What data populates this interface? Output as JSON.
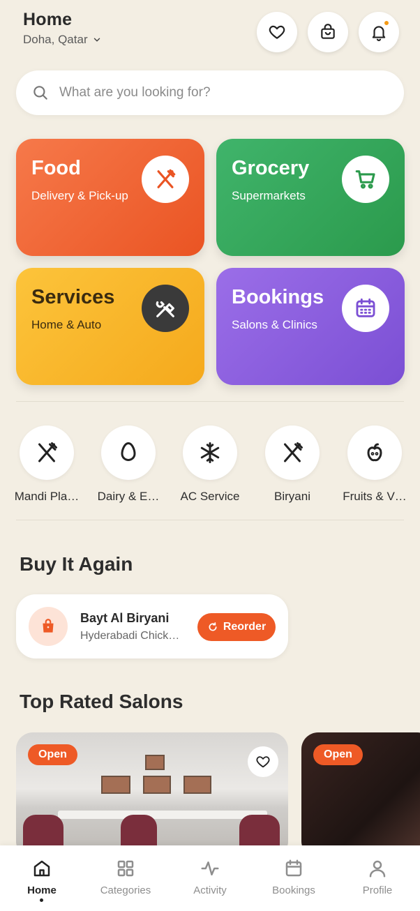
{
  "header": {
    "title": "Home",
    "location": "Doha, Qatar"
  },
  "search": {
    "placeholder": "What are you looking for?"
  },
  "categories": [
    {
      "name": "Food",
      "subtitle": "Delivery & Pick-up",
      "color": "#ea5423",
      "icon": "fork-knife-icon"
    },
    {
      "name": "Grocery",
      "subtitle": "Supermarkets",
      "color": "#2b9a4c",
      "icon": "cart-icon"
    },
    {
      "name": "Services",
      "subtitle": "Home & Auto",
      "color": "#f5a91c",
      "icon": "tools-icon"
    },
    {
      "name": "Bookings",
      "subtitle": "Salons & Clinics",
      "color": "#7b4fd4",
      "icon": "calendar-icon"
    }
  ],
  "quick_links": [
    {
      "label": "Mandi Pla…",
      "icon": "fork-knife-icon"
    },
    {
      "label": "Dairy & E…",
      "icon": "egg-icon"
    },
    {
      "label": "AC Service",
      "icon": "snowflake-icon"
    },
    {
      "label": "Biryani",
      "icon": "fork-knife-icon"
    },
    {
      "label": "Fruits & V…",
      "icon": "apple-icon"
    }
  ],
  "buy_again": {
    "title": "Buy It Again",
    "restaurant": "Bayt Al Biryani",
    "item": "Hyderabadi Chick…",
    "button": "Reorder"
  },
  "top_salons": {
    "title": "Top Rated Salons",
    "cards": [
      {
        "status": "Open"
      },
      {
        "status": "Open"
      }
    ]
  },
  "nav": [
    {
      "label": "Home",
      "active": true
    },
    {
      "label": "Categories"
    },
    {
      "label": "Activity"
    },
    {
      "label": "Bookings"
    },
    {
      "label": "Profile"
    }
  ]
}
